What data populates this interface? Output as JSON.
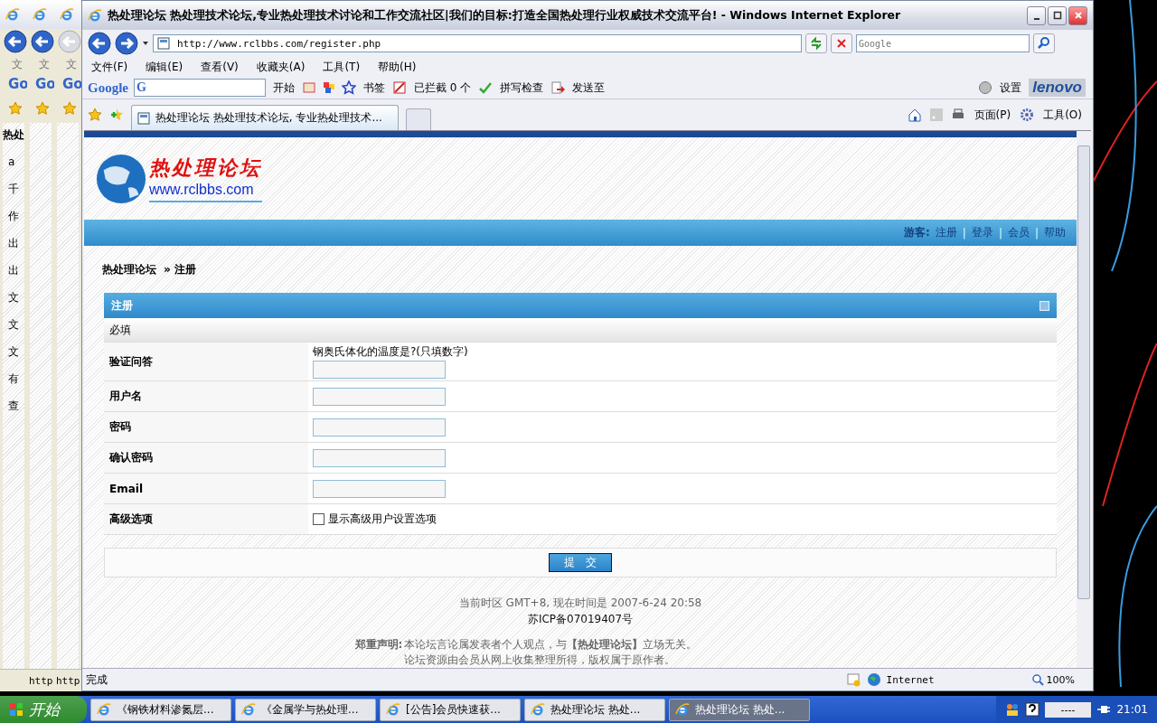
{
  "back_windows": [
    {
      "menu": "文",
      "google": "Go",
      "back_enabled": true,
      "content": [
        "热处",
        "a",
        "千",
        "作",
        "出",
        "出",
        "文",
        "文",
        "文",
        "有",
        "查"
      ]
    },
    {
      "menu": "文",
      "google": "Go",
      "back_enabled": true,
      "status": "http"
    },
    {
      "menu": "文",
      "google": "Go",
      "back_enabled": false,
      "status": "http"
    }
  ],
  "window": {
    "title": "热处理论坛  热处理技术论坛,专业热处理技术讨论和工作交流社区|我们的目标:打造全国热处理行业权威技术交流平台! - Windows Internet Explorer",
    "address": "http://www.rclbbs.com/register.php",
    "search_placeholder": "Google",
    "menu": [
      "文件(F)",
      "编辑(E)",
      "查看(V)",
      "收藏夹(A)",
      "工具(T)",
      "帮助(H)"
    ],
    "google_bar": {
      "logo": "Google",
      "engine": "G",
      "go": "开始",
      "bookmarks": "书签",
      "blocked": "已拦截  0 个",
      "spell": "拼写检查",
      "send": "发送至",
      "settings": "设置",
      "brand": "lenovo"
    },
    "tabs": [
      {
        "label": "热处理论坛 热处理技术论坛, 专业热处理技术...",
        "selected": true
      }
    ],
    "commands": [
      "页面(P)",
      "工具(O)"
    ],
    "status": "完成",
    "zone": "Internet",
    "zoom": "100%"
  },
  "page": {
    "logo_title": "热处理论坛",
    "logo_url": "www.rclbbs.com",
    "nav": {
      "label": "游客:",
      "separator": "|",
      "links": [
        "注册",
        "登录",
        "会员",
        "帮助"
      ]
    },
    "breadcrumb": [
      "热处理论坛",
      "» 注册"
    ],
    "form": {
      "title": "注册",
      "section": "必填",
      "rows": [
        {
          "kind": "text",
          "label": "验证问答",
          "question": "钢奥氏体化的温度是?(只填数字)"
        },
        {
          "kind": "text",
          "label": "用户名"
        },
        {
          "kind": "text",
          "label": "密码"
        },
        {
          "kind": "text",
          "label": "确认密码"
        },
        {
          "kind": "text",
          "label": "Email"
        },
        {
          "kind": "checkbox",
          "label": "高级选项",
          "option": "显示高级用户设置选项",
          "checked": false
        }
      ],
      "submit": "提　交"
    },
    "footer": {
      "timezone": "当前时区  GMT+8, 现在时间是  2007-6-24 20:58",
      "icp": "苏ICP备07019407号",
      "notice_label": "郑重声明:",
      "notice": [
        "本论坛言论属发表者个人观点，与**【热处理论坛】**立场无关。",
        "论坛资源由会员从网上收集整理所得，版权属于原作者。"
      ]
    }
  },
  "taskbar": {
    "start": "开始",
    "items": [
      {
        "label": "《钢铁材料渗氮层...",
        "selected": false
      },
      {
        "label": "《金属学与热处理...",
        "selected": false
      },
      {
        "label": "[公告]会员快速获...",
        "selected": false
      },
      {
        "label": "热处理论坛 热处...",
        "selected": false
      },
      {
        "label": "热处理论坛 热处...",
        "selected": true
      }
    ],
    "tray_text": "----",
    "clock": "21:01"
  }
}
